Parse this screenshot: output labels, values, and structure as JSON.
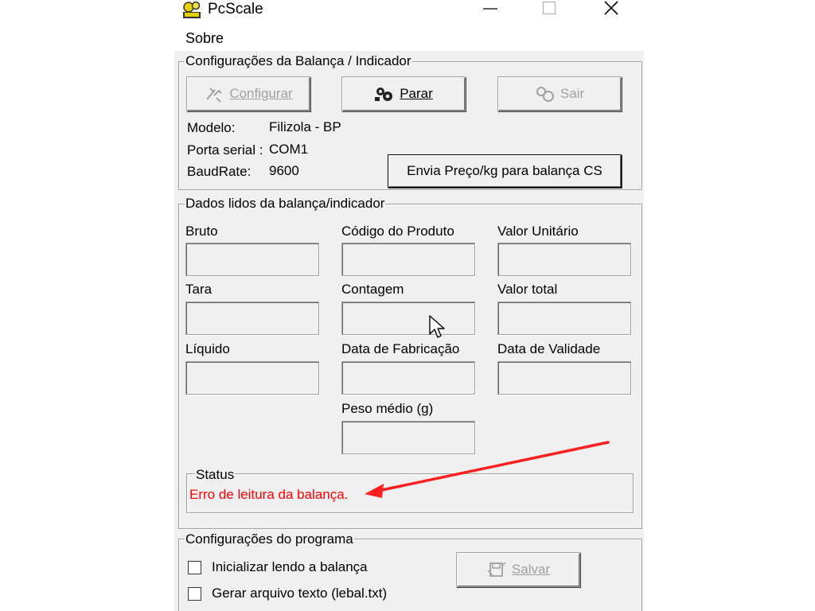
{
  "window": {
    "title": "PcScale",
    "controls": {
      "minimize": "—",
      "maximize": "☐",
      "close": "✕"
    }
  },
  "menu": {
    "items": [
      "Sobre"
    ]
  },
  "config_group": {
    "legend": "Configurações da Balança / Indicador",
    "buttons": {
      "configurar": "Configurar",
      "parar": "Parar",
      "sair": "Sair",
      "envia": "Envia Preço/kg para balança CS"
    },
    "modelo_label": "Modelo:",
    "modelo_value": "Filizola - BP",
    "porta_label": "Porta serial :",
    "porta_value": "COM1",
    "baud_label": "BaudRate:",
    "baud_value": "9600"
  },
  "dados_group": {
    "legend": "Dados lidos da balança/indicador",
    "fields": {
      "bruto": "Bruto",
      "codigo": "Código do Produto",
      "valor_unitario": "Valor Unitário",
      "tara": "Tara",
      "contagem": "Contagem",
      "valor_total": "Valor total",
      "liquido": "Líquido",
      "data_fabricacao": "Data de Fabricação",
      "data_validade": "Data de Validade",
      "peso_medio": "Peso médio (g)"
    },
    "status_legend": "Status",
    "status_text": "Erro de leitura da balança."
  },
  "programa_group": {
    "legend": "Configurações do programa",
    "checkbox1": "Inicializar lendo a balança",
    "checkbox2": "Gerar arquivo texto (lebal.txt)",
    "salvar": "Salvar"
  },
  "colors": {
    "status_error": "#ff0000",
    "arrow": "#ff2020",
    "window_bg": "#f0f0f0"
  }
}
